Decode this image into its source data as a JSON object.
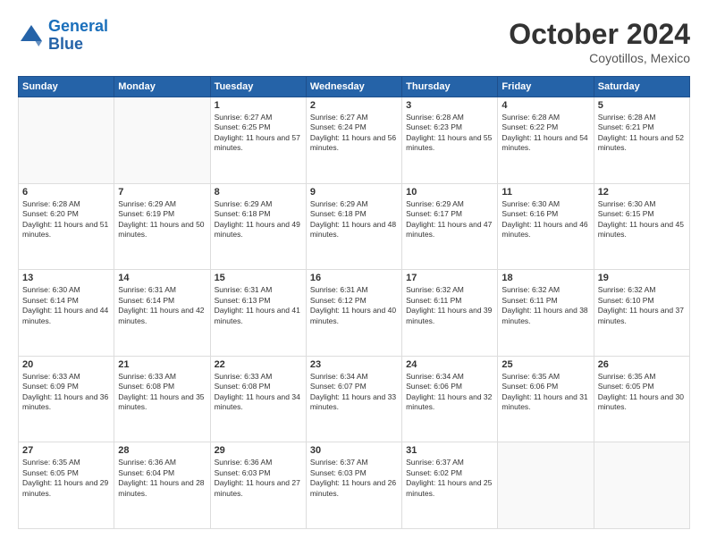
{
  "header": {
    "logo_line1": "General",
    "logo_line2": "Blue",
    "month": "October 2024",
    "location": "Coyotillos, Mexico"
  },
  "weekdays": [
    "Sunday",
    "Monday",
    "Tuesday",
    "Wednesday",
    "Thursday",
    "Friday",
    "Saturday"
  ],
  "weeks": [
    [
      {
        "day": "",
        "info": ""
      },
      {
        "day": "",
        "info": ""
      },
      {
        "day": "1",
        "info": "Sunrise: 6:27 AM\nSunset: 6:25 PM\nDaylight: 11 hours and 57 minutes."
      },
      {
        "day": "2",
        "info": "Sunrise: 6:27 AM\nSunset: 6:24 PM\nDaylight: 11 hours and 56 minutes."
      },
      {
        "day": "3",
        "info": "Sunrise: 6:28 AM\nSunset: 6:23 PM\nDaylight: 11 hours and 55 minutes."
      },
      {
        "day": "4",
        "info": "Sunrise: 6:28 AM\nSunset: 6:22 PM\nDaylight: 11 hours and 54 minutes."
      },
      {
        "day": "5",
        "info": "Sunrise: 6:28 AM\nSunset: 6:21 PM\nDaylight: 11 hours and 52 minutes."
      }
    ],
    [
      {
        "day": "6",
        "info": "Sunrise: 6:28 AM\nSunset: 6:20 PM\nDaylight: 11 hours and 51 minutes."
      },
      {
        "day": "7",
        "info": "Sunrise: 6:29 AM\nSunset: 6:19 PM\nDaylight: 11 hours and 50 minutes."
      },
      {
        "day": "8",
        "info": "Sunrise: 6:29 AM\nSunset: 6:18 PM\nDaylight: 11 hours and 49 minutes."
      },
      {
        "day": "9",
        "info": "Sunrise: 6:29 AM\nSunset: 6:18 PM\nDaylight: 11 hours and 48 minutes."
      },
      {
        "day": "10",
        "info": "Sunrise: 6:29 AM\nSunset: 6:17 PM\nDaylight: 11 hours and 47 minutes."
      },
      {
        "day": "11",
        "info": "Sunrise: 6:30 AM\nSunset: 6:16 PM\nDaylight: 11 hours and 46 minutes."
      },
      {
        "day": "12",
        "info": "Sunrise: 6:30 AM\nSunset: 6:15 PM\nDaylight: 11 hours and 45 minutes."
      }
    ],
    [
      {
        "day": "13",
        "info": "Sunrise: 6:30 AM\nSunset: 6:14 PM\nDaylight: 11 hours and 44 minutes."
      },
      {
        "day": "14",
        "info": "Sunrise: 6:31 AM\nSunset: 6:14 PM\nDaylight: 11 hours and 42 minutes."
      },
      {
        "day": "15",
        "info": "Sunrise: 6:31 AM\nSunset: 6:13 PM\nDaylight: 11 hours and 41 minutes."
      },
      {
        "day": "16",
        "info": "Sunrise: 6:31 AM\nSunset: 6:12 PM\nDaylight: 11 hours and 40 minutes."
      },
      {
        "day": "17",
        "info": "Sunrise: 6:32 AM\nSunset: 6:11 PM\nDaylight: 11 hours and 39 minutes."
      },
      {
        "day": "18",
        "info": "Sunrise: 6:32 AM\nSunset: 6:11 PM\nDaylight: 11 hours and 38 minutes."
      },
      {
        "day": "19",
        "info": "Sunrise: 6:32 AM\nSunset: 6:10 PM\nDaylight: 11 hours and 37 minutes."
      }
    ],
    [
      {
        "day": "20",
        "info": "Sunrise: 6:33 AM\nSunset: 6:09 PM\nDaylight: 11 hours and 36 minutes."
      },
      {
        "day": "21",
        "info": "Sunrise: 6:33 AM\nSunset: 6:08 PM\nDaylight: 11 hours and 35 minutes."
      },
      {
        "day": "22",
        "info": "Sunrise: 6:33 AM\nSunset: 6:08 PM\nDaylight: 11 hours and 34 minutes."
      },
      {
        "day": "23",
        "info": "Sunrise: 6:34 AM\nSunset: 6:07 PM\nDaylight: 11 hours and 33 minutes."
      },
      {
        "day": "24",
        "info": "Sunrise: 6:34 AM\nSunset: 6:06 PM\nDaylight: 11 hours and 32 minutes."
      },
      {
        "day": "25",
        "info": "Sunrise: 6:35 AM\nSunset: 6:06 PM\nDaylight: 11 hours and 31 minutes."
      },
      {
        "day": "26",
        "info": "Sunrise: 6:35 AM\nSunset: 6:05 PM\nDaylight: 11 hours and 30 minutes."
      }
    ],
    [
      {
        "day": "27",
        "info": "Sunrise: 6:35 AM\nSunset: 6:05 PM\nDaylight: 11 hours and 29 minutes."
      },
      {
        "day": "28",
        "info": "Sunrise: 6:36 AM\nSunset: 6:04 PM\nDaylight: 11 hours and 28 minutes."
      },
      {
        "day": "29",
        "info": "Sunrise: 6:36 AM\nSunset: 6:03 PM\nDaylight: 11 hours and 27 minutes."
      },
      {
        "day": "30",
        "info": "Sunrise: 6:37 AM\nSunset: 6:03 PM\nDaylight: 11 hours and 26 minutes."
      },
      {
        "day": "31",
        "info": "Sunrise: 6:37 AM\nSunset: 6:02 PM\nDaylight: 11 hours and 25 minutes."
      },
      {
        "day": "",
        "info": ""
      },
      {
        "day": "",
        "info": ""
      }
    ]
  ]
}
